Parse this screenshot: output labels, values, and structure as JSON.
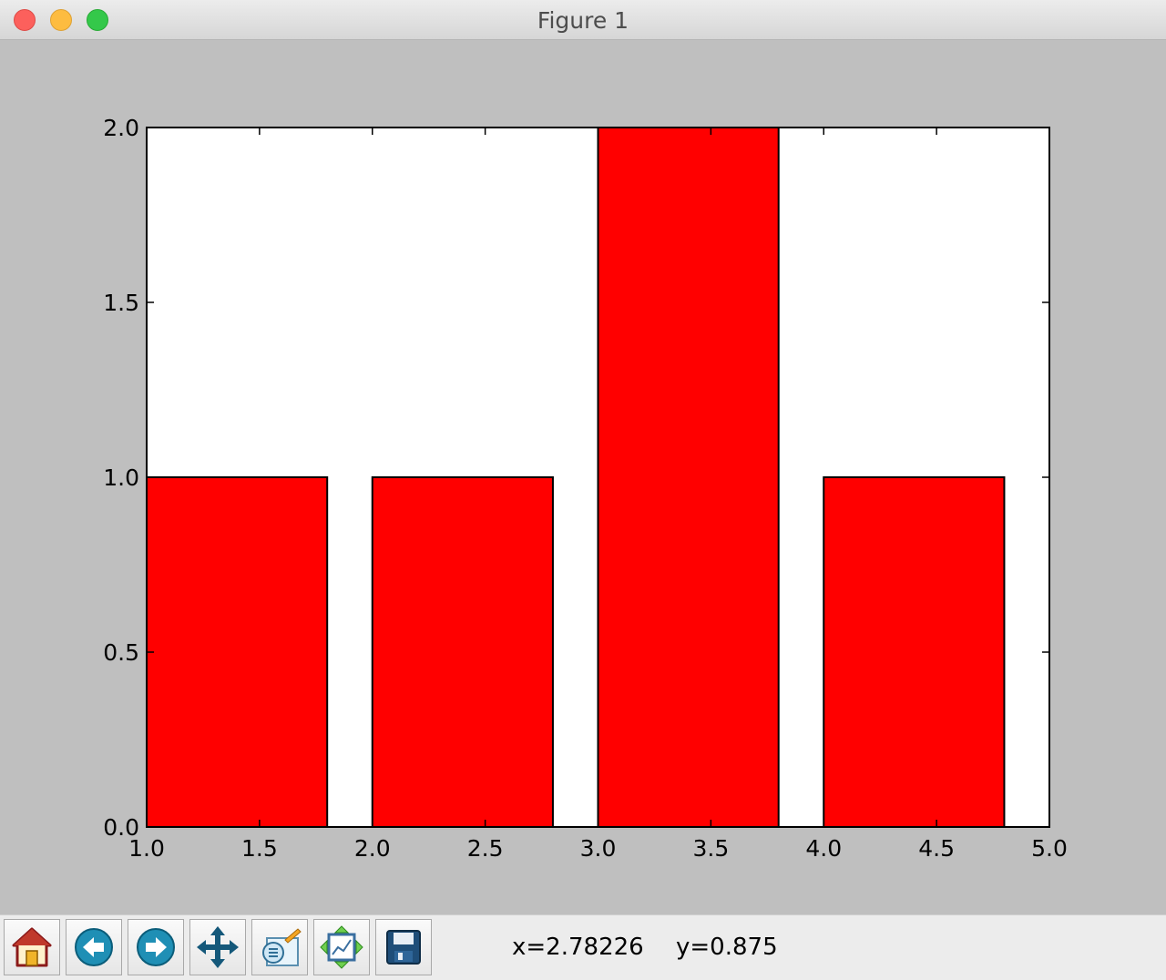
{
  "window": {
    "title": "Figure 1"
  },
  "toolbar": {
    "buttons": [
      {
        "name": "home",
        "icon": "home-icon"
      },
      {
        "name": "back",
        "icon": "back-arrow-icon"
      },
      {
        "name": "forward",
        "icon": "forward-arrow-icon"
      },
      {
        "name": "pan",
        "icon": "pan-move-icon"
      },
      {
        "name": "zoom",
        "icon": "zoom-rect-icon"
      },
      {
        "name": "subplots",
        "icon": "configure-subplots-icon"
      },
      {
        "name": "save",
        "icon": "save-floppy-icon"
      }
    ],
    "x_readout": "x=2.78226",
    "y_readout": "y=0.875"
  },
  "colors": {
    "bar_fill": "#ff0000",
    "figure_bg": "#bfbfbf",
    "axes_bg": "#ffffff"
  },
  "chart_data": {
    "type": "bar",
    "title": "",
    "xlabel": "",
    "ylabel": "",
    "xlim": [
      1.0,
      5.0
    ],
    "ylim": [
      0.0,
      2.0
    ],
    "xticks": [
      "1.0",
      "1.5",
      "2.0",
      "2.5",
      "3.0",
      "3.5",
      "4.0",
      "4.5",
      "5.0"
    ],
    "yticks": [
      "0.0",
      "0.5",
      "1.0",
      "1.5",
      "2.0"
    ],
    "bars": [
      {
        "left": 1.0,
        "width": 0.8,
        "value": 1
      },
      {
        "left": 2.0,
        "width": 0.8,
        "value": 1
      },
      {
        "left": 3.0,
        "width": 0.8,
        "value": 2
      },
      {
        "left": 4.0,
        "width": 0.8,
        "value": 1
      }
    ],
    "grid": false,
    "legend": "none"
  }
}
